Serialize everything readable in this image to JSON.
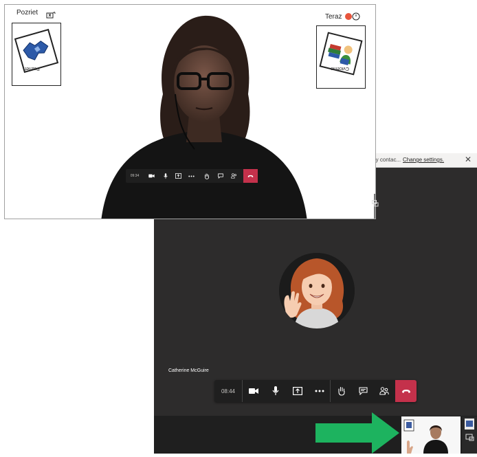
{
  "notification": {
    "text": "rity contac...",
    "link": "Change settings.",
    "close": "✕"
  },
  "participant": {
    "name": "Catherine McGuire"
  },
  "toolbar_big": {
    "time": "08:44"
  },
  "toolbar_small": {
    "time": "09:34"
  },
  "cards": {
    "left_label": "Pozriet",
    "left_icon_label": "Pozriet",
    "right_label": "Teraz",
    "right_icon_label": "Cvicenie"
  },
  "colors": {
    "teams_bg": "#2d2c2c",
    "toolbar_bg": "#1f1f1f",
    "hangup": "#c4314b",
    "arrow": "#1db35f"
  }
}
